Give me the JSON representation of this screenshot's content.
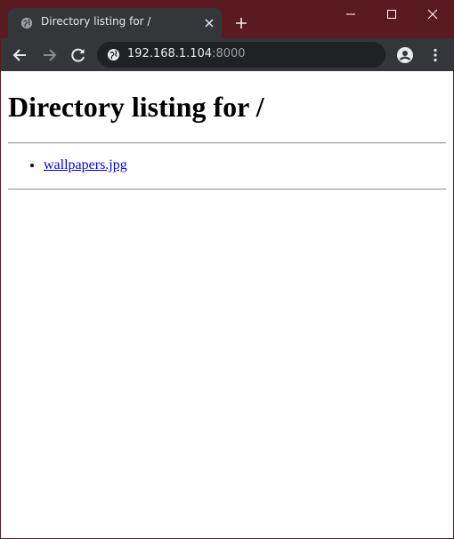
{
  "browser": {
    "tab": {
      "title": "Directory listing for /",
      "favicon": "globe-icon"
    },
    "window_controls": {
      "minimize": "minimize-icon",
      "maximize": "maximize-icon",
      "close": "close-icon"
    },
    "toolbar": {
      "url_host": "192.168.1.104",
      "url_port": ":8000"
    },
    "colors": {
      "frame": "#5a1b20",
      "toolbar": "#35363a",
      "omnibox": "#202124",
      "link": "#0000ee"
    }
  },
  "page": {
    "heading": "Directory listing for /",
    "files": [
      {
        "name": "wallpapers.jpg"
      }
    ]
  }
}
